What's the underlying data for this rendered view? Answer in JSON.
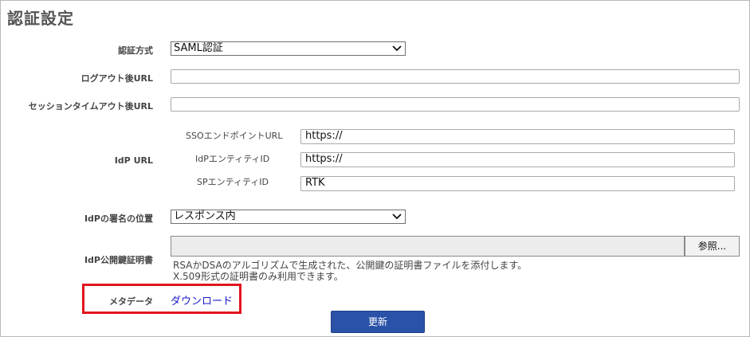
{
  "page": {
    "title": "認証設定"
  },
  "fields": {
    "auth_method": {
      "label": "認証方式",
      "value": "SAML認証"
    },
    "logout_url": {
      "label": "ログアウト後URL",
      "value": ""
    },
    "session_timeout_url": {
      "label": "セッションタイムアウト後URL",
      "value": ""
    },
    "idp_url": {
      "label": "IdP URL",
      "sso_endpoint": {
        "label": "SSOエンドポイントURL",
        "value": "https://"
      },
      "idp_entity_id": {
        "label": "IdPエンティティID",
        "value": "https://"
      },
      "sp_entity_id": {
        "label": "SPエンティティID",
        "value": "RTK"
      }
    },
    "signature_position": {
      "label": "IdPの署名の位置",
      "value": "レスポンス内"
    },
    "idp_certificate": {
      "label": "IdP公開鍵証明書",
      "browse_label": "参照...",
      "help_line1": "RSAかDSAのアルゴリズムで生成された、公開鍵の証明書ファイルを添付します。",
      "help_line2": "X.509形式の証明書のみ利用できます。"
    },
    "metadata": {
      "label": "メタデータ",
      "link_label": "ダウンロード"
    }
  },
  "submit_label": "更新",
  "colors": {
    "link": "#1a1acc",
    "highlight": "#e0141e",
    "submit_bg": "#2a52a8"
  }
}
